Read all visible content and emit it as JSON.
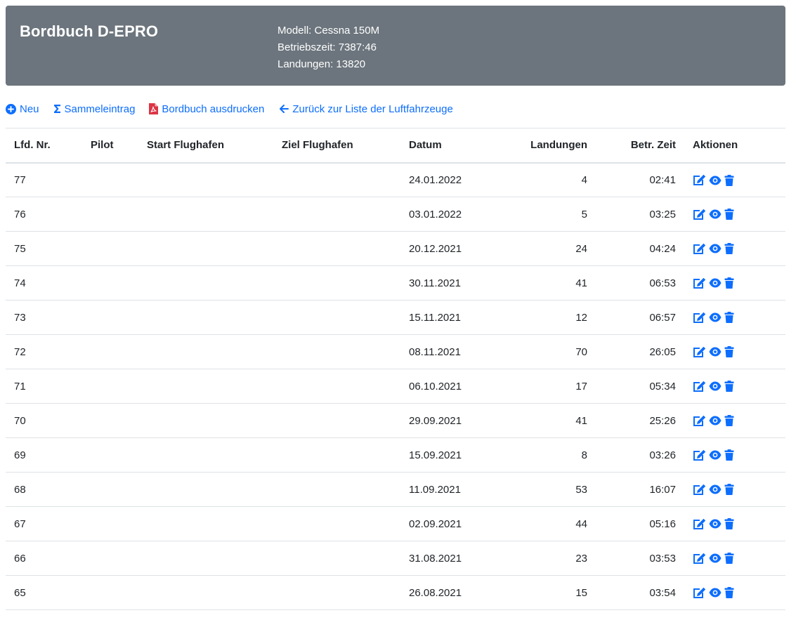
{
  "header": {
    "title": "Bordbuch D-EPRO",
    "model": "Modell: Cessna 150M",
    "operating_time": "Betriebszeit: 7387:46",
    "landings": "Landungen: 13820"
  },
  "toolbar": {
    "new_label": "Neu",
    "collective_label": "Sammeleintrag",
    "print_label": "Bordbuch ausdrucken",
    "back_label": "Zurück zur Liste der Luftfahrzeuge"
  },
  "table": {
    "columns": [
      "Lfd. Nr.",
      "Pilot",
      "Start Flughafen",
      "Ziel Flughafen",
      "Datum",
      "Landungen",
      "Betr. Zeit",
      "Aktionen"
    ],
    "rows": [
      {
        "nr": "77",
        "pilot": "",
        "start": "",
        "ziel": "",
        "datum": "24.01.2022",
        "landungen": "4",
        "zeit": "02:41"
      },
      {
        "nr": "76",
        "pilot": "",
        "start": "",
        "ziel": "",
        "datum": "03.01.2022",
        "landungen": "5",
        "zeit": "03:25"
      },
      {
        "nr": "75",
        "pilot": "",
        "start": "",
        "ziel": "",
        "datum": "20.12.2021",
        "landungen": "24",
        "zeit": "04:24"
      },
      {
        "nr": "74",
        "pilot": "",
        "start": "",
        "ziel": "",
        "datum": "30.11.2021",
        "landungen": "41",
        "zeit": "06:53"
      },
      {
        "nr": "73",
        "pilot": "",
        "start": "",
        "ziel": "",
        "datum": "15.11.2021",
        "landungen": "12",
        "zeit": "06:57"
      },
      {
        "nr": "72",
        "pilot": "",
        "start": "",
        "ziel": "",
        "datum": "08.11.2021",
        "landungen": "70",
        "zeit": "26:05"
      },
      {
        "nr": "71",
        "pilot": "",
        "start": "",
        "ziel": "",
        "datum": "06.10.2021",
        "landungen": "17",
        "zeit": "05:34"
      },
      {
        "nr": "70",
        "pilot": "",
        "start": "",
        "ziel": "",
        "datum": "29.09.2021",
        "landungen": "41",
        "zeit": "25:26"
      },
      {
        "nr": "69",
        "pilot": "",
        "start": "",
        "ziel": "",
        "datum": "15.09.2021",
        "landungen": "8",
        "zeit": "03:26"
      },
      {
        "nr": "68",
        "pilot": "",
        "start": "",
        "ziel": "",
        "datum": "11.09.2021",
        "landungen": "53",
        "zeit": "16:07"
      },
      {
        "nr": "67",
        "pilot": "",
        "start": "",
        "ziel": "",
        "datum": "02.09.2021",
        "landungen": "44",
        "zeit": "05:16"
      },
      {
        "nr": "66",
        "pilot": "",
        "start": "",
        "ziel": "",
        "datum": "31.08.2021",
        "landungen": "23",
        "zeit": "03:53"
      },
      {
        "nr": "65",
        "pilot": "",
        "start": "",
        "ziel": "",
        "datum": "26.08.2021",
        "landungen": "15",
        "zeit": "03:54"
      }
    ]
  },
  "icons": {
    "new": "plus-circle-icon",
    "collective": "sigma-icon",
    "print": "pdf-file-icon",
    "back": "arrow-left-icon",
    "edit": "edit-icon",
    "view": "eye-icon",
    "delete": "trash-icon"
  },
  "colors": {
    "header_bg": "#6c757d",
    "link": "#0d6efd",
    "pdf": "#dc3545",
    "action": "#0d6efd"
  }
}
